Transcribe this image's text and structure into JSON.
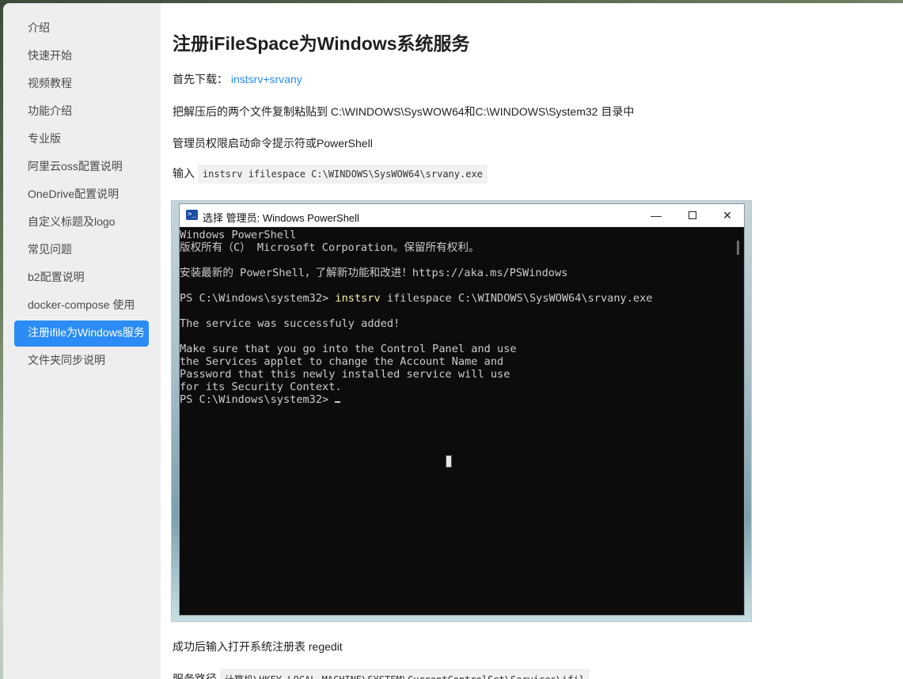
{
  "sidebar": {
    "items": [
      {
        "label": "介绍"
      },
      {
        "label": "快速开始"
      },
      {
        "label": "视频教程"
      },
      {
        "label": "功能介绍"
      },
      {
        "label": "专业版"
      },
      {
        "label": "阿里云oss配置说明"
      },
      {
        "label": "OneDrive配置说明"
      },
      {
        "label": "自定义标题及logo"
      },
      {
        "label": "常见问题"
      },
      {
        "label": "b2配置说明"
      },
      {
        "label": "docker-compose 使用"
      },
      {
        "label": "注册ifile为Windows服务"
      },
      {
        "label": "文件夹同步说明"
      }
    ],
    "active_index": 11,
    "active_color": "#2b8cf5"
  },
  "main": {
    "title": "注册iFileSpace为Windows系统服务",
    "download_prefix": "首先下载：",
    "download_link": "instsrv+srvany",
    "copy_instruction": "把解压后的两个文件复制粘贴到 C:\\WINDOWS\\SysWOW64和C:\\WINDOWS\\System32 目录中",
    "admin_instruction": "管理员权限启动命令提示符或PowerShell",
    "input_prefix": "输入",
    "input_command": "instsrv ifilespace C:\\WINDOWS\\SysWOW64\\srvany.exe",
    "after_success": "成功后输入打开系统注册表 regedit",
    "service_path_prefix": "服务路径",
    "service_path_value": "计算机\\HKEY_LOCAL_MACHINE\\SYSTEM\\CurrentControlSet\\Services\\ifil"
  },
  "powershell": {
    "title": "选择 管理员: Windows PowerShell",
    "icon": "powershell-icon",
    "console": {
      "line1": "Windows PowerShell",
      "line2": "版权所有（C） Microsoft Corporation。保留所有权利。",
      "line3": "安装最新的 PowerShell，了解新功能和改进！https://aka.ms/PSWindows",
      "prompt1": "PS C:\\Windows\\system32> ",
      "cmd_kw": "instsrv",
      "cmd_rest": " ifilespace C:\\WINDOWS\\SysWOW64\\srvany.exe",
      "line5": "The service was successfuly added!",
      "line6": "Make sure that you go into the Control Panel and use",
      "line7": "the Services applet to change the Account Name and",
      "line8": "Password that this newly installed service will use",
      "line9": "for its Security Context.",
      "prompt2": "PS C:\\Windows\\system32> "
    }
  }
}
